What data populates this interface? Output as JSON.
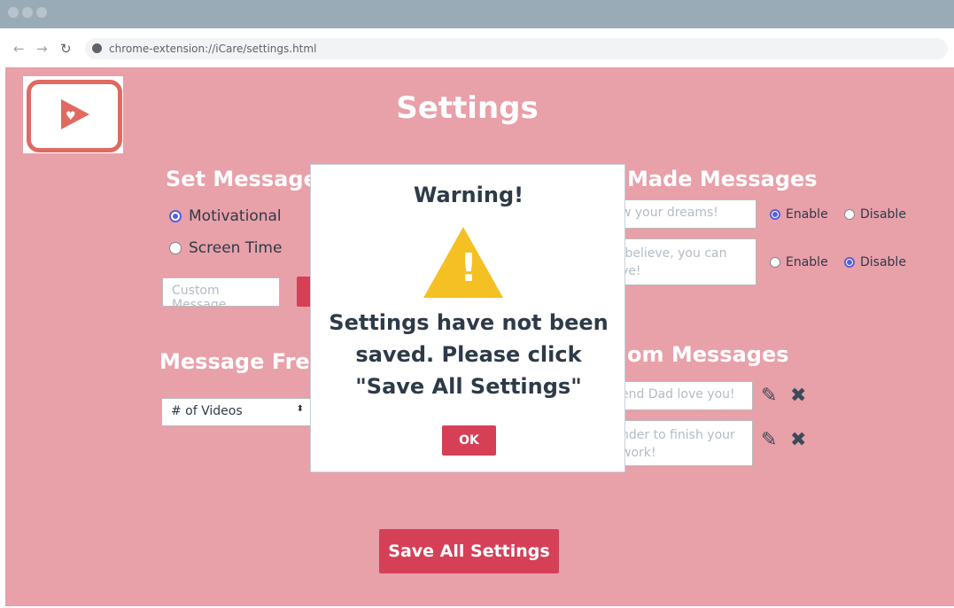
{
  "browser": {
    "url": "chrome-extension://iCare/settings.html"
  },
  "page": {
    "title": "Settings"
  },
  "set_messages": {
    "heading": "Set Messages",
    "options": [
      {
        "label": "Motivational",
        "selected": true
      },
      {
        "label": "Screen Time",
        "selected": false
      }
    ],
    "custom_placeholder": "Custom Message"
  },
  "premade": {
    "heading": "Made Messages",
    "items": [
      {
        "text": "w your dreams!",
        "enable": "Enable",
        "disable": "Disable",
        "enabled": true
      },
      {
        "text": " believe, you can\nve!",
        "enable": "Enable",
        "disable": "Disable",
        "enabled": false
      }
    ]
  },
  "frequency": {
    "heading": "Message Frequ",
    "select_value": "# of Videos"
  },
  "custom": {
    "heading": "om Messages",
    "items": [
      {
        "text": "end Dad love you!"
      },
      {
        "text": "nder to finish your\nwork!"
      }
    ]
  },
  "save_label": "Save All Settings",
  "modal": {
    "title": "Warning!",
    "icon_glyph": "!",
    "body": "Settings have not been saved. Please click \"Save All Settings\"",
    "ok_label": "OK"
  },
  "colors": {
    "page_bg": "#e8a0a9",
    "accent": "#d54057",
    "warning": "#f5c023",
    "radio": "#5a5fd8",
    "text": "#2e3a48"
  }
}
